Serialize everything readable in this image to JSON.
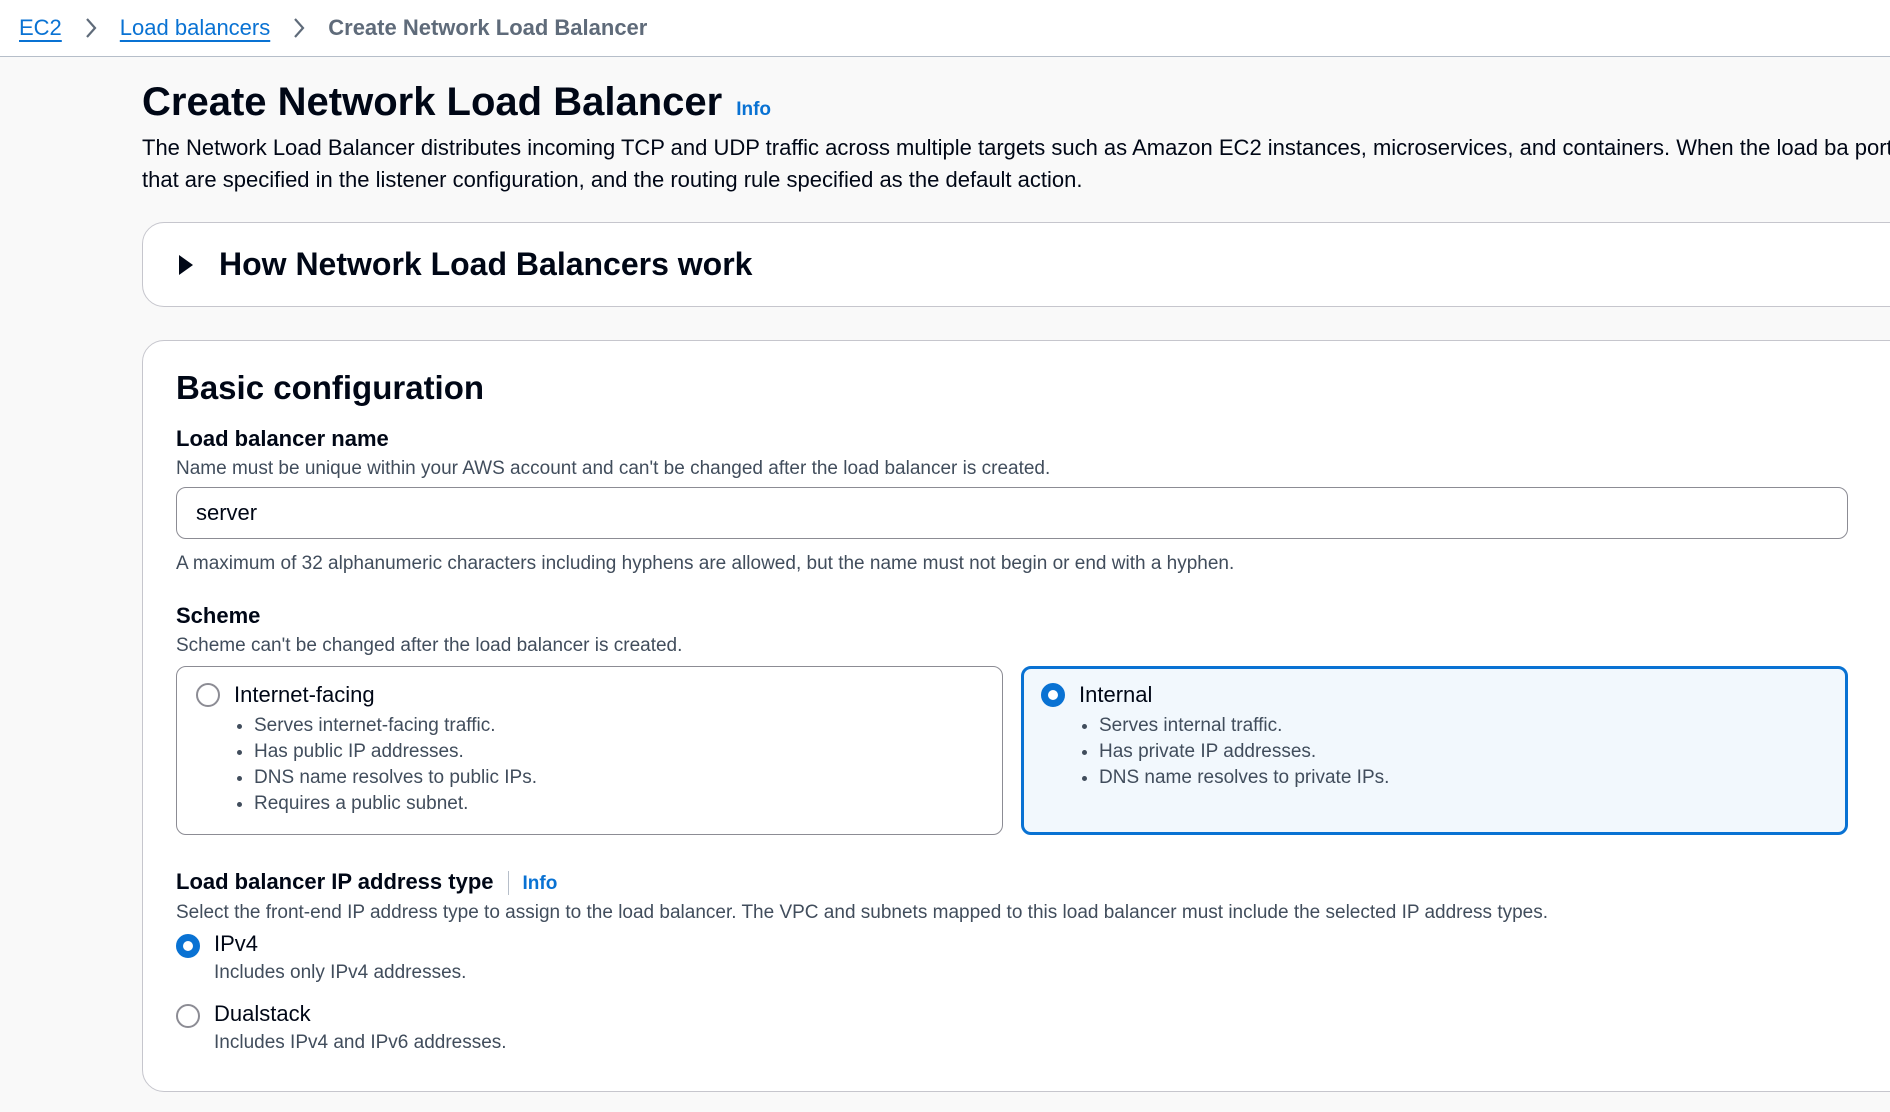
{
  "breadcrumb": {
    "items": [
      "EC2",
      "Load balancers"
    ],
    "current": "Create Network Load Balancer"
  },
  "header": {
    "title": "Create Network Load Balancer",
    "info": "Info",
    "description": "The Network Load Balancer distributes incoming TCP and UDP traffic across multiple targets such as Amazon EC2 instances, microservices, and containers. When the load ba port that are specified in the listener configuration, and the routing rule specified as the default action."
  },
  "how_it_works": {
    "title": "How Network Load Balancers work"
  },
  "basic": {
    "title": "Basic configuration",
    "name_label": "Load balancer name",
    "name_desc": "Name must be unique within your AWS account and can't be changed after the load balancer is created.",
    "name_value": "server",
    "name_hint": "A maximum of 32 alphanumeric characters including hyphens are allowed, but the name must not begin or end with a hyphen.",
    "scheme_label": "Scheme",
    "scheme_desc": "Scheme can't be changed after the load balancer is created.",
    "scheme_options": [
      {
        "title": "Internet-facing",
        "bullets": [
          "Serves internet-facing traffic.",
          "Has public IP addresses.",
          "DNS name resolves to public IPs.",
          "Requires a public subnet."
        ],
        "selected": false
      },
      {
        "title": "Internal",
        "bullets": [
          "Serves internal traffic.",
          "Has private IP addresses.",
          "DNS name resolves to private IPs."
        ],
        "selected": true
      }
    ],
    "ip_label": "Load balancer IP address type",
    "ip_info": "Info",
    "ip_desc": "Select the front-end IP address type to assign to the load balancer. The VPC and subnets mapped to this load balancer must include the selected IP address types.",
    "ip_options": [
      {
        "title": "IPv4",
        "desc": "Includes only IPv4 addresses.",
        "selected": true
      },
      {
        "title": "Dualstack",
        "desc": "Includes IPv4 and IPv6 addresses.",
        "selected": false
      }
    ]
  },
  "colors": {
    "accent": "#0972d3",
    "text": "#000716",
    "muted": "#414d5c"
  }
}
